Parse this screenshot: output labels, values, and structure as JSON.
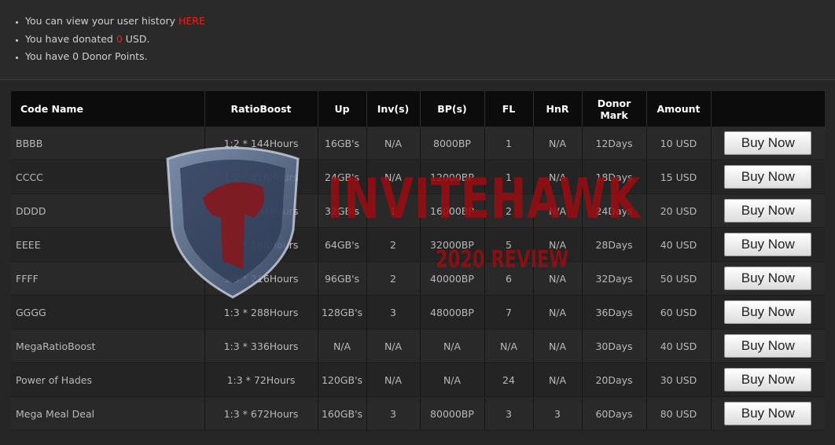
{
  "info": {
    "history_prefix": "You can view your user history ",
    "history_link": "HERE",
    "donated_prefix": "You have donated ",
    "donated_amount": "0",
    "donated_suffix": " USD.",
    "points_text": "You have 0 Donor Points."
  },
  "table": {
    "headers": {
      "code_name": "Code Name",
      "ratio_boost": "RatioBoost",
      "up": "Up",
      "inv": "Inv(s)",
      "bp": "BP(s)",
      "fl": "FL",
      "hnr": "HnR",
      "donor_mark_line1": "Donor",
      "donor_mark_line2": "Mark",
      "amount": "Amount"
    },
    "rows": [
      {
        "name": "BBBB",
        "ratio": "1:2 * 144Hours",
        "up": "16GB's",
        "inv": "N/A",
        "bp": "8000BP",
        "fl": "1",
        "hnr": "N/A",
        "mark": "12Days",
        "amount": "10 USD",
        "button": "Buy Now"
      },
      {
        "name": "CCCC",
        "ratio": "1:2 * 216Hours",
        "up": "24GB's",
        "inv": "N/A",
        "bp": "12000BP",
        "fl": "1",
        "hnr": "N/A",
        "mark": "18Days",
        "amount": "15 USD",
        "button": "Buy Now"
      },
      {
        "name": "DDDD",
        "ratio": "1:2 * 264Hours",
        "up": "32GB's",
        "inv": "1",
        "bp": "16000BP",
        "fl": "2",
        "hnr": "N/A",
        "mark": "24Days",
        "amount": "20 USD",
        "button": "Buy Now"
      },
      {
        "name": "EEEE",
        "ratio": "1:3 * 168Hours",
        "up": "64GB's",
        "inv": "2",
        "bp": "32000BP",
        "fl": "5",
        "hnr": "N/A",
        "mark": "28Days",
        "amount": "40 USD",
        "button": "Buy Now"
      },
      {
        "name": "FFFF",
        "ratio": "1:3 * 216Hours",
        "up": "96GB's",
        "inv": "2",
        "bp": "40000BP",
        "fl": "6",
        "hnr": "N/A",
        "mark": "32Days",
        "amount": "50 USD",
        "button": "Buy Now"
      },
      {
        "name": "GGGG",
        "ratio": "1:3 * 288Hours",
        "up": "128GB's",
        "inv": "3",
        "bp": "48000BP",
        "fl": "7",
        "hnr": "N/A",
        "mark": "36Days",
        "amount": "60 USD",
        "button": "Buy Now"
      },
      {
        "name": "MegaRatioBoost",
        "ratio": "1:3 * 336Hours",
        "up": "N/A",
        "inv": "N/A",
        "bp": "N/A",
        "fl": "N/A",
        "hnr": "N/A",
        "mark": "30Days",
        "amount": "40 USD",
        "button": "Buy Now"
      },
      {
        "name": "Power of Hades",
        "ratio": "1:3 * 72Hours",
        "up": "120GB's",
        "inv": "N/A",
        "bp": "N/A",
        "fl": "24",
        "hnr": "N/A",
        "mark": "20Days",
        "amount": "30 USD",
        "button": "Buy Now"
      },
      {
        "name": "Mega Meal Deal",
        "ratio": "1:3 * 672Hours",
        "up": "160GB's",
        "inv": "3",
        "bp": "80000BP",
        "fl": "3",
        "hnr": "3",
        "mark": "60Days",
        "amount": "80 USD",
        "button": "Buy Now"
      }
    ]
  },
  "watermark": {
    "title": "INVITEHAWK",
    "subtitle": "2020 REVIEW"
  },
  "colors": {
    "accent_red": "#e8231f",
    "background": "#262626",
    "header_bg": "#0c0c0c"
  }
}
